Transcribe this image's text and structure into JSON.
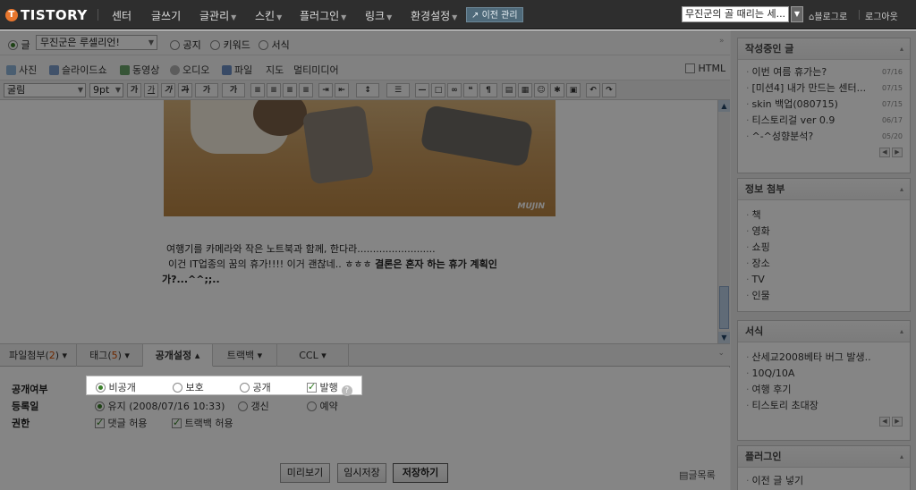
{
  "topnav": {
    "logo": "TISTORY",
    "items": [
      {
        "label": "센터",
        "has_menu": false
      },
      {
        "label": "글쓰기",
        "has_menu": false
      },
      {
        "label": "글관리",
        "has_menu": true
      },
      {
        "label": "스킨",
        "has_menu": true
      },
      {
        "label": "플러그인",
        "has_menu": true
      },
      {
        "label": "링크",
        "has_menu": true
      },
      {
        "label": "환경설정",
        "has_menu": true
      }
    ],
    "old_management": "이전 관리",
    "blog_select": "무진군의 골 때리는 세...",
    "blog_link": "블로그로",
    "logout": "로그아웃"
  },
  "post_type": {
    "options": [
      "글",
      "공지",
      "키워드",
      "서식"
    ],
    "selected": "글",
    "category": "무진군은 루셀리언!"
  },
  "media_toolbar": {
    "items": [
      "사진",
      "슬라이드쇼",
      "동영상",
      "오디오",
      "파일",
      "지도",
      "멀티미디어"
    ],
    "html_label": "HTML",
    "colors": [
      "#8fb4d8",
      "#7e9ecc",
      "#6aa36a",
      "#b0b0b0",
      "#6c8fc4"
    ]
  },
  "format_toolbar": {
    "font": "굴림",
    "size": "9pt",
    "buttons": [
      "가",
      "가",
      "가",
      "가",
      "가",
      "가"
    ]
  },
  "content": {
    "image_watermark": "MUJIN",
    "line1": "여행기를 카메라와 작은 노트북과 함께, 한다라.........................",
    "line2_normal": "이건 IT업종의 꿈의 휴가!!!! 이거 괜찮네.. ㅎㅎㅎ ",
    "line2_bold": "결론은 혼자 하는 휴가 계획인",
    "line3": "가?...^^;;.."
  },
  "bottom_tabs": [
    {
      "label": "파일첨부",
      "count": "2"
    },
    {
      "label": "태그",
      "count": "5"
    },
    {
      "label": "공개설정",
      "count": ""
    },
    {
      "label": "트랙백",
      "count": ""
    },
    {
      "label": "CCL",
      "count": ""
    }
  ],
  "settings": {
    "visibility_label": "공개여부",
    "visibility_options": [
      "비공개",
      "보호",
      "공개"
    ],
    "visibility_selected": "비공개",
    "publish_label": "발행",
    "publish_checked": true,
    "date_label": "등록일",
    "date_options": [
      "유지 (2008/07/16 10:33)",
      "갱신",
      "예약"
    ],
    "date_selected": "유지 (2008/07/16 10:33)",
    "perm_label": "권한",
    "perm_options": [
      "댓글 허용",
      "트랙백 허용"
    ]
  },
  "buttons": {
    "preview": "미리보기",
    "temp_save": "임시저장",
    "save": "저장하기",
    "list": "글목록"
  },
  "sidebar": {
    "drafts_title": "작성중인 글",
    "drafts": [
      {
        "title": "이번 여름 휴가는?",
        "date": "07/16"
      },
      {
        "title": "[미션4] 내가 만드는 센터...",
        "date": "07/15"
      },
      {
        "title": "skin 백업(080715)",
        "date": "07/15"
      },
      {
        "title": "티스토리걸 ver 0.9",
        "date": "06/17"
      },
      {
        "title": "^-^성향분석?",
        "date": "05/20"
      }
    ],
    "info_title": "정보 첨부",
    "info_items": [
      "책",
      "영화",
      "쇼핑",
      "장소",
      "TV",
      "인물"
    ],
    "form_title": "서식",
    "form_items": [
      "산세교2008베타 버그 발생..",
      "10Q/10A",
      "여행 후기",
      "티스토리 초대장"
    ],
    "plugin_title": "플러그인",
    "plugin_items": [
      "이전 글 넣기"
    ]
  }
}
